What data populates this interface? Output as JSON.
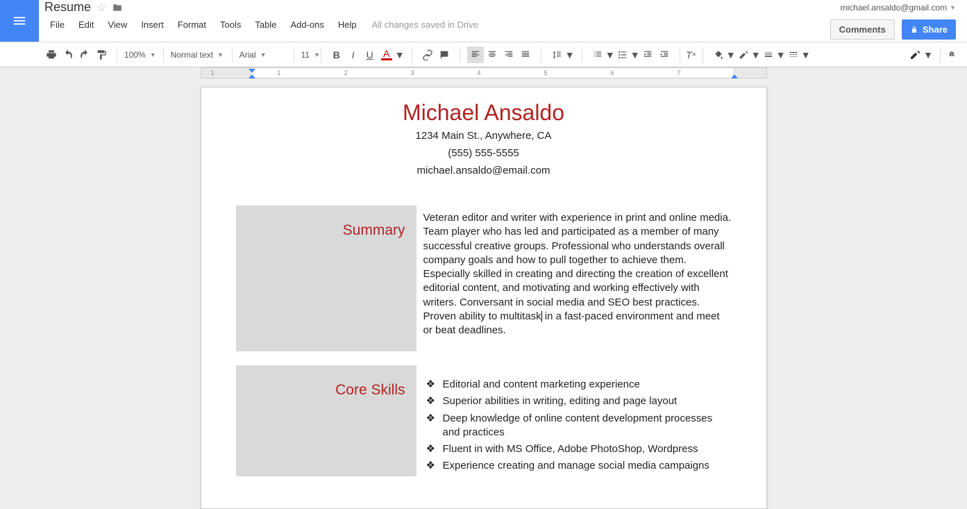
{
  "account": {
    "email": "michael.ansaldo@gmail.com"
  },
  "doc": {
    "title": "Resume"
  },
  "menus": {
    "file": "File",
    "edit": "Edit",
    "view": "View",
    "insert": "Insert",
    "format": "Format",
    "tools": "Tools",
    "table": "Table",
    "addons": "Add-ons",
    "help": "Help"
  },
  "status": "All changes saved in Drive",
  "header_buttons": {
    "comments": "Comments",
    "share": "Share"
  },
  "toolbar": {
    "zoom": "100%",
    "style": "Normal text",
    "font": "Arial",
    "size": "11"
  },
  "ruler": {
    "ticks": [
      "1",
      "2",
      "3",
      "4",
      "5",
      "6",
      "7"
    ]
  },
  "resume": {
    "name": "Michael Ansaldo",
    "address": "1234 Main St., Anywhere, CA",
    "phone": "(555) 555-5555",
    "email": "michael.ansaldo@email.com",
    "summary_label": "Summary",
    "summary_p1": "Veteran editor and writer with experience in print and online media. Team player who has led and participated as a member of many successful creative groups. Professional who understands overall company goals and how to pull together to achieve them. Especially skilled in creating and directing the creation of excellent editorial content, and motivating and working effectively with writers. Conversant in social media and SEO best practices. Proven ability to multitask",
    "summary_p2": " in a fast-paced environment and meet or beat deadlines.",
    "skills_label": "Core Skills",
    "skills": [
      "Editorial and content marketing experience",
      "Superior abilities in writing, editing and page layout",
      "Deep knowledge of online content development processes and practices",
      "Fluent in with MS Office, Adobe PhotoShop, Wordpress",
      "Experience creating and manage social media campaigns"
    ]
  }
}
